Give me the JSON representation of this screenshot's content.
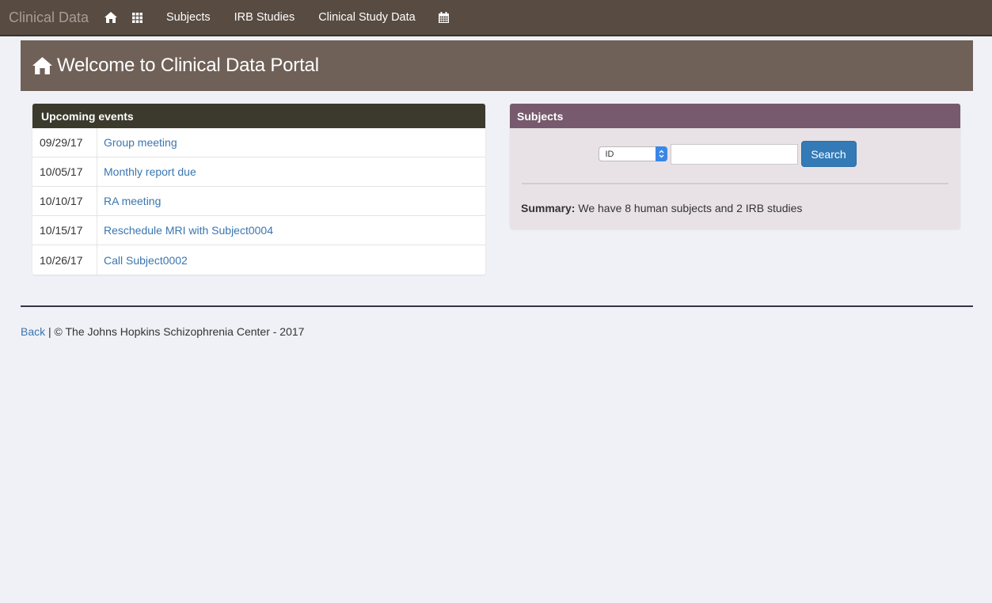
{
  "navbar": {
    "brand": "Clinical Data",
    "icons": [
      "home-icon",
      "grid-icon",
      "calendar-icon"
    ],
    "links": [
      "Subjects",
      "IRB Studies",
      "Clinical Study Data"
    ]
  },
  "banner": {
    "title": "Welcome to Clinical Data Portal",
    "icon": "home-icon"
  },
  "events": {
    "heading": "Upcoming events",
    "rows": [
      {
        "date": "09/29/17",
        "title": "Group meeting"
      },
      {
        "date": "10/05/17",
        "title": "Monthly report due"
      },
      {
        "date": "10/10/17",
        "title": "RA meeting"
      },
      {
        "date": "10/15/17",
        "title": "Reschedule MRI with Subject0004"
      },
      {
        "date": "10/26/17",
        "title": "Call Subject0002"
      }
    ]
  },
  "subjects": {
    "heading": "Subjects",
    "select_value": "ID",
    "search_value": "",
    "search_label": "Search",
    "summary_label": "Summary:",
    "summary_text": " We have 8 human subjects and 2 IRB studies"
  },
  "footer": {
    "back_label": "Back",
    "copyright": " | © The Johns Hopkins Schizophrenia Center - 2017"
  },
  "colors": {
    "navbar": "#574b42",
    "banner": "#6f6158",
    "events_heading": "#3b3a2d",
    "subjects_heading": "#775a6d",
    "subjects_body": "#e8e2e6",
    "link": "#3a76b0",
    "primary_button": "#337ab7"
  }
}
